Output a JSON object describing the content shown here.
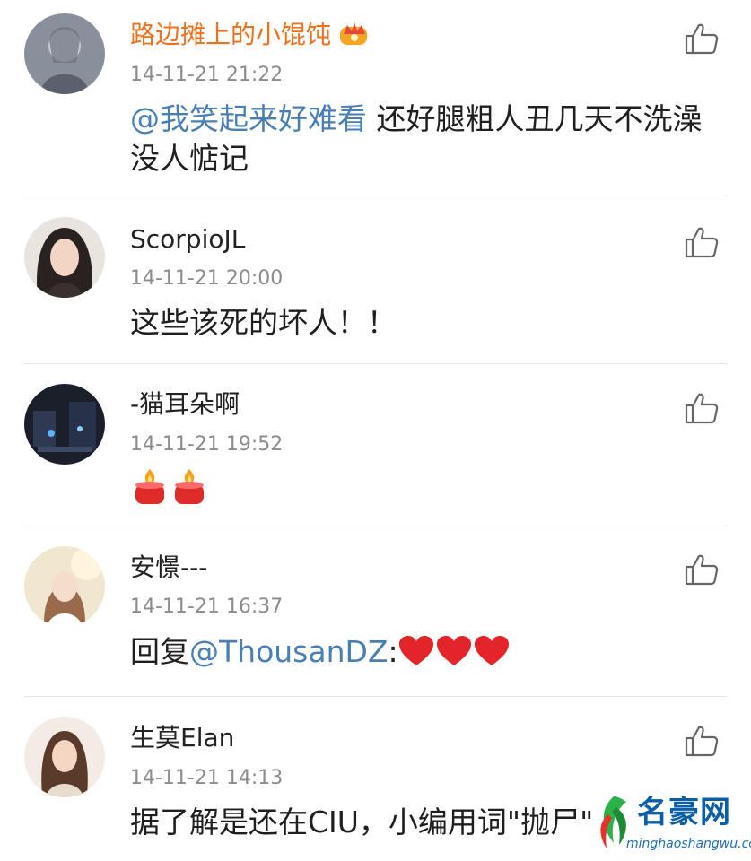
{
  "comments": [
    {
      "username": "路边摊上的小馄饨",
      "time": "14-11-21 21:22",
      "mention": "@我笑起来好难看",
      "text": " 还好腿粗人丑几天不洗澡没人惦记"
    },
    {
      "username": "ScorpioJL",
      "time": "14-11-21 20:00",
      "text": "这些该死的坏人！！"
    },
    {
      "username": "-猫耳朵啊",
      "time": "14-11-21 19:52",
      "emoji": "candle-emoji"
    },
    {
      "username": "安憬---",
      "time": "14-11-21 16:37",
      "prefix": "回复",
      "mention": "@ThousanDZ",
      "suffix": ":",
      "emoji": "heart-emoji"
    },
    {
      "username": "生莫Elan",
      "time": "14-11-21 14:13",
      "text": "据了解是还在CIU，小编用词\"抛尸\""
    }
  ],
  "icons": {
    "like": "thumbs-up-icon",
    "vip": "crown-icon"
  },
  "colors": {
    "vip_name": "#f0711c",
    "mention": "#4a7fb5",
    "time": "#8c8c8c"
  },
  "watermark": {
    "title": "名豪网",
    "subtitle": "minghaoshangwu.com"
  }
}
